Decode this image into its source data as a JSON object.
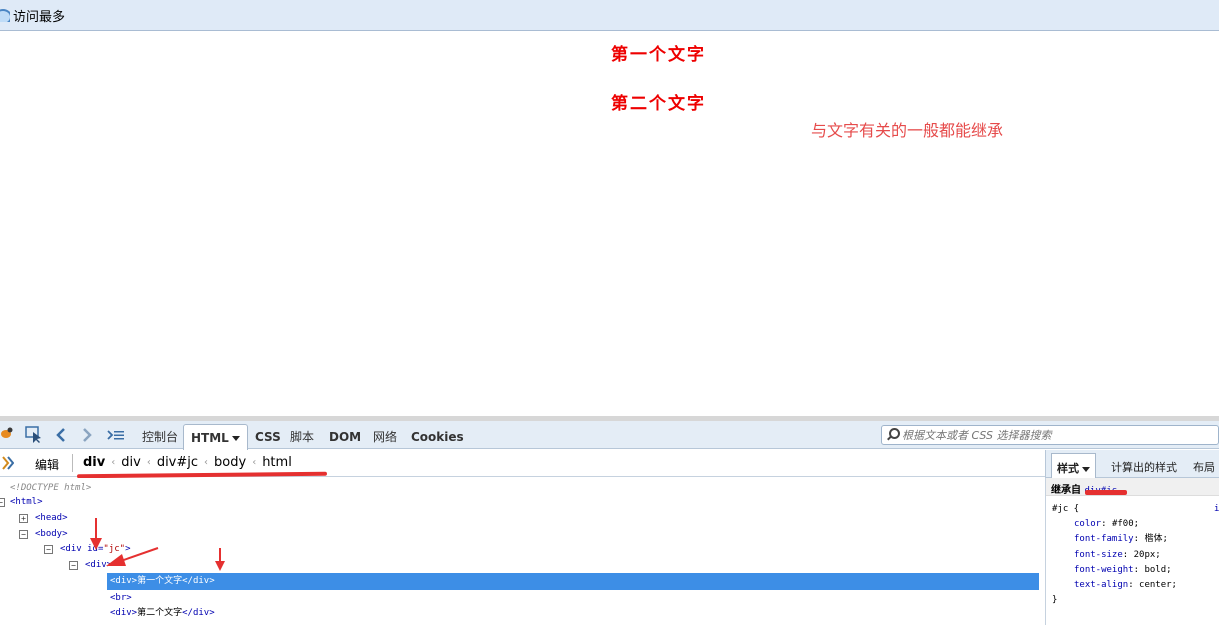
{
  "bookmarks": {
    "item_label": "访问最多",
    "icon": "bookmark-icon"
  },
  "page": {
    "line1": "第一个文字",
    "line2": "第二个文字",
    "note": "与文字有关的一般都能继承",
    "text_color": "#ee0000"
  },
  "devtools": {
    "tabs": {
      "console": "控制台",
      "html": "HTML",
      "css": "CSS",
      "script": "脚本",
      "dom": "DOM",
      "net": "网络",
      "cookies": "Cookies"
    },
    "search_placeholder": "根据文本或者 CSS 选择器搜索",
    "edit_label": "编辑",
    "breadcrumbs": [
      "div",
      "div",
      "div#jc",
      "body",
      "html"
    ],
    "side_tabs": {
      "style": "样式",
      "computed": "计算出的样式",
      "layout": "布局"
    },
    "tree": {
      "doctype": "<!DOCTYPE html>",
      "html": "<html>",
      "head": "<head>",
      "body": "<body>",
      "div_open": "<div",
      "div_attr": " id=",
      "div_val": "\"jc\"",
      "div_close": ">",
      "inner_div": "<div>",
      "sel_open": "<div>",
      "sel_text": "第一个文字",
      "sel_close": "</div>",
      "br": "<br>",
      "div2_open": "<div>",
      "div2_text": "第二个文字",
      "div2_close": "</div>"
    },
    "style_panel": {
      "inherit_label": "继承自",
      "inherit_source": "div#jc",
      "selector": "#jc {",
      "props": [
        {
          "name": "color",
          "value": "#f00;"
        },
        {
          "name": "font-family",
          "value": "楷体;"
        },
        {
          "name": "font-size",
          "value": "20px;"
        },
        {
          "name": "font-weight",
          "value": "bold;"
        },
        {
          "name": "text-align",
          "value": "center;"
        }
      ],
      "close": "}",
      "right_char": "i"
    },
    "accent_color": "#3d8ee6",
    "annotation_color": "#e53030"
  }
}
